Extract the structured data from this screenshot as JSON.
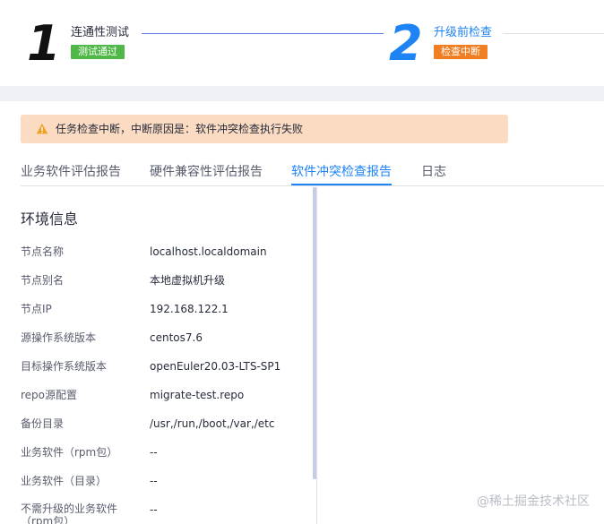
{
  "steps": [
    {
      "number": "1",
      "title": "连通性测试",
      "status": "测试通过",
      "status_color": "#50b848"
    },
    {
      "number": "2",
      "title": "升级前检查",
      "status": "检查中断",
      "status_color": "#f07f24"
    }
  ],
  "alert": {
    "icon": "warning-icon",
    "text": "任务检查中断，中断原因是：软件冲突检查执行失败",
    "bg_color": "#fcdbc3"
  },
  "tabs": [
    {
      "label": "业务软件评估报告",
      "active": false
    },
    {
      "label": "硬件兼容性评估报告",
      "active": false
    },
    {
      "label": "软件冲突检查报告",
      "active": true
    },
    {
      "label": "日志",
      "active": false
    }
  ],
  "env": {
    "title": "环境信息",
    "rows": [
      {
        "label": "节点名称",
        "value": "localhost.localdomain"
      },
      {
        "label": "节点别名",
        "value": "本地虚拟机升级"
      },
      {
        "label": "节点IP",
        "value": "192.168.122.1"
      },
      {
        "label": "源操作系统版本",
        "value": "centos7.6"
      },
      {
        "label": "目标操作系统版本",
        "value": "openEuler20.03-LTS-SP1"
      },
      {
        "label": "repo源配置",
        "value": "migrate-test.repo"
      },
      {
        "label": "备份目录",
        "value": "/usr,/run,/boot,/var,/etc"
      },
      {
        "label": "业务软件（rpm包）",
        "value": "--"
      },
      {
        "label": "业务软件（目录）",
        "value": "--"
      },
      {
        "label": "不需升级的业务软件（rpm包）",
        "value": "--"
      }
    ]
  },
  "watermark": "@稀土掘金技术社区",
  "colors": {
    "accent": "#1e83f4",
    "success": "#50b848",
    "warning": "#f07f24"
  }
}
